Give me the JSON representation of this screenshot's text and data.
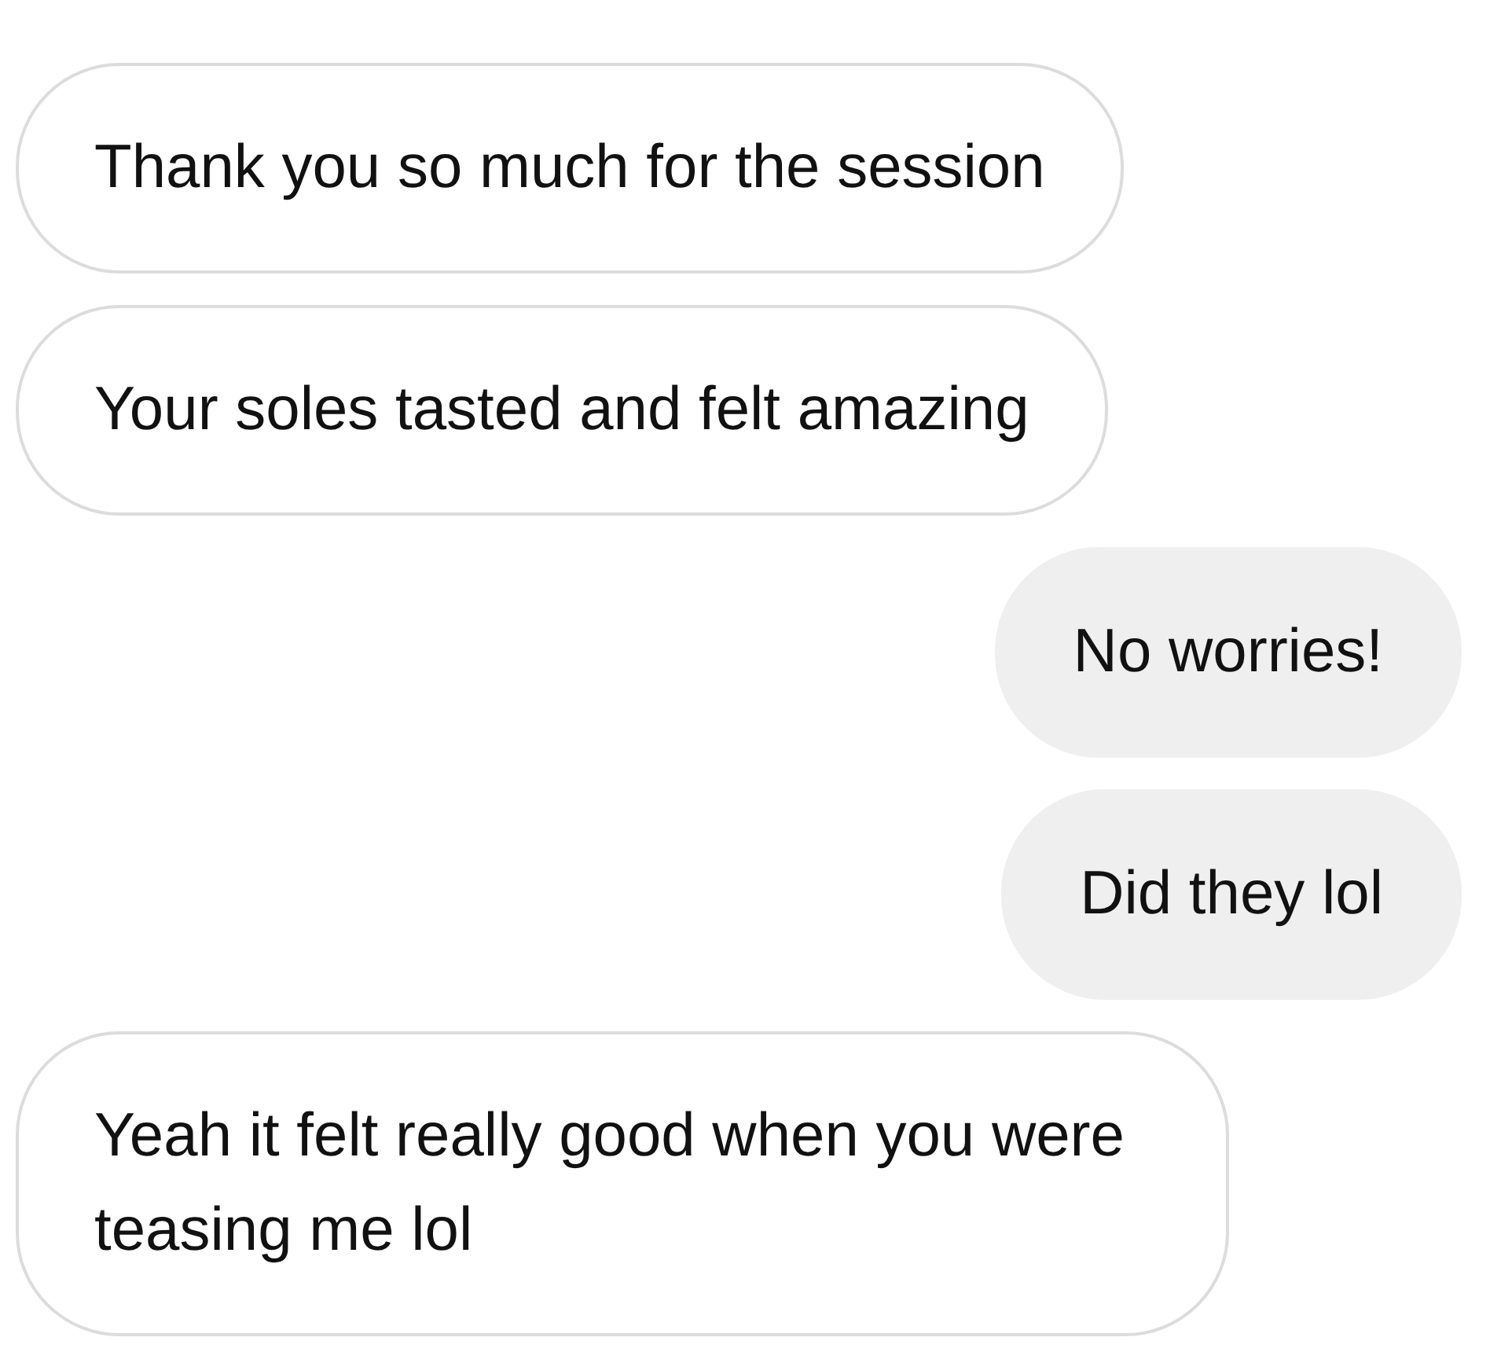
{
  "messages": [
    {
      "kind": "incoming",
      "text": "Thank you so much for the session"
    },
    {
      "kind": "incoming",
      "text": "Your soles tasted and felt amazing"
    },
    {
      "kind": "outgoing",
      "text": "No worries!"
    },
    {
      "kind": "outgoing",
      "text": "Did they lol"
    },
    {
      "kind": "incoming",
      "text": "Yeah it felt really good when you were teasing me lol"
    }
  ]
}
